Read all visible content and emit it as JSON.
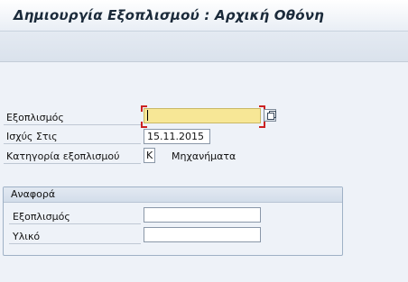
{
  "window": {
    "title": "Δημιουργία Εξοπλισμού : Αρχική Οθόνη"
  },
  "form": {
    "equipment": {
      "label": "Εξοπλισμός",
      "value": ""
    },
    "valid_from": {
      "label": "Ισχύς Στις",
      "value": "15.11.2015"
    },
    "category": {
      "label": "Κατηγορία εξοπλισμού",
      "value": "K",
      "description": "Μηχανήματα"
    }
  },
  "reference": {
    "title": "Αναφορά",
    "equipment": {
      "label": "Εξοπλισμός",
      "value": ""
    },
    "material": {
      "label": "Υλικό",
      "value": ""
    }
  },
  "colors": {
    "active_field": "#f7e796",
    "required_marker": "#cc2222"
  },
  "icons": {
    "search_help": "value-help-icon"
  }
}
